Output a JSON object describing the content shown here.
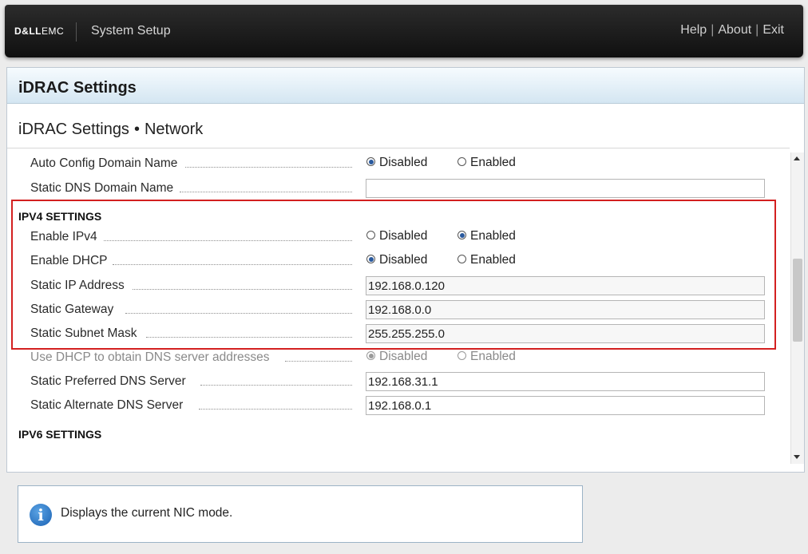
{
  "header": {
    "brand_dell": "D&LL",
    "brand_emc": "EMC",
    "app_title": "System Setup",
    "links": {
      "help": "Help",
      "about": "About",
      "exit": "Exit"
    },
    "link_separator": "|"
  },
  "panel": {
    "title": "iDRAC Settings",
    "breadcrumb": [
      "iDRAC Settings",
      "Network"
    ],
    "breadcrumb_separator": "•"
  },
  "options": {
    "disabled": "Disabled",
    "enabled": "Enabled"
  },
  "rows": {
    "auto_config_domain": {
      "label": "Auto Config Domain Name",
      "selected": "Disabled"
    },
    "static_dns_domain": {
      "label": "Static DNS Domain Name",
      "value": ""
    },
    "ipv4_heading": "IPV4 SETTINGS",
    "enable_ipv4": {
      "label": "Enable IPv4",
      "selected": "Enabled"
    },
    "enable_dhcp": {
      "label": "Enable DHCP",
      "selected": "Disabled"
    },
    "static_ip": {
      "label": "Static IP Address",
      "value": "192.168.0.120"
    },
    "static_gateway": {
      "label": "Static Gateway",
      "value": "192.168.0.0"
    },
    "static_subnet": {
      "label": "Static Subnet Mask",
      "value": "255.255.255.0"
    },
    "dhcp_dns": {
      "label": "Use DHCP to obtain DNS server addresses",
      "selected": "Disabled",
      "disabled": true
    },
    "preferred_dns": {
      "label": "Static Preferred DNS Server",
      "value": "192.168.31.1"
    },
    "alternate_dns": {
      "label": "Static Alternate DNS Server",
      "value": "192.168.0.1"
    },
    "ipv6_heading": "IPV6 SETTINGS"
  },
  "info": {
    "text": "Displays the current NIC mode.",
    "icon": "info-icon"
  },
  "colors": {
    "highlight": "#d32020",
    "radio_checked": "#2a5a9e",
    "header_bg": "#1a1a1a"
  }
}
